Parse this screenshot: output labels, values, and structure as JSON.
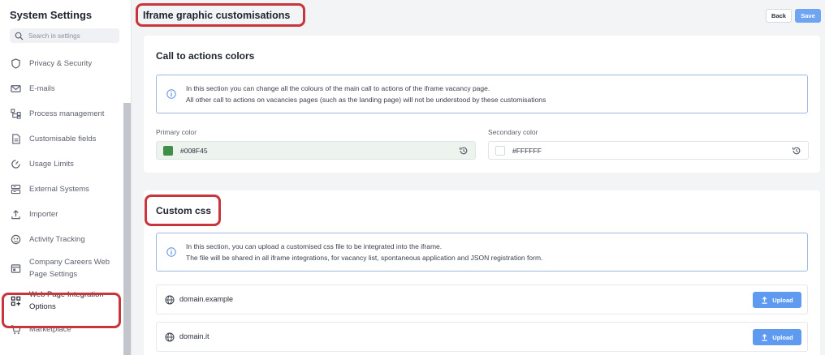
{
  "sidebar": {
    "title": "System Settings",
    "search_placeholder": "Search in settings",
    "items": [
      {
        "label": "Privacy & Security",
        "icon": "shield-icon"
      },
      {
        "label": "E-mails",
        "icon": "mail-icon"
      },
      {
        "label": "Process management",
        "icon": "process-icon"
      },
      {
        "label": "Customisable fields",
        "icon": "document-icon"
      },
      {
        "label": "Usage Limits",
        "icon": "gauge-icon"
      },
      {
        "label": "External Systems",
        "icon": "server-icon"
      },
      {
        "label": "Importer",
        "icon": "upload-icon"
      },
      {
        "label": "Activity Tracking",
        "icon": "tracking-icon"
      },
      {
        "label": "Company Careers Web Page Settings",
        "icon": "webpage-icon"
      },
      {
        "label": "Web Page Integration Options",
        "icon": "grid-plus-icon",
        "active": true
      },
      {
        "label": "Marketplace",
        "icon": "cart-icon"
      }
    ]
  },
  "header": {
    "title": "Iframe graphic customisations",
    "back_label": "Back",
    "save_label": "Save"
  },
  "cta": {
    "title": "Call to actions colors",
    "info_line1": "In this section you can change all the colours of the main call to actions of the iframe vacancy page.",
    "info_line2": "All other call to actions on vacancies pages (such as the landing page) will not be understood by these customisations",
    "primary_label": "Primary color",
    "primary_value": "#008F45",
    "secondary_label": "Secondary color",
    "secondary_value": "#FFFFFF"
  },
  "css": {
    "title": "Custom css",
    "info_line1": "In this section, you can upload a customised css file to be integrated into the iframe.",
    "info_line2": "The file will be shared in all iframe integrations, for vacancy list, spontaneous application and JSON registration form.",
    "upload_label": "Upload",
    "domains": [
      "domain.example",
      "domain.it"
    ]
  },
  "colors": {
    "accent": "#6ea4f2",
    "highlight": "#c8353a",
    "primary_swatch": "#3f8f4a",
    "primary_field_bg": "#edf4ee"
  }
}
